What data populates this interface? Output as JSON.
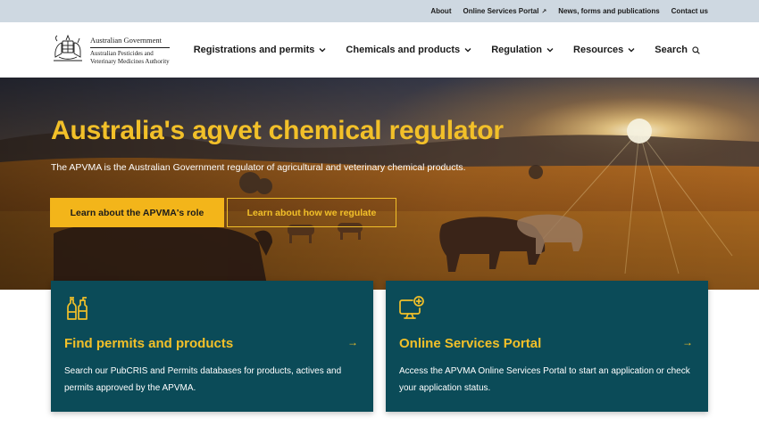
{
  "utility": {
    "links": [
      {
        "label": "About"
      },
      {
        "label": "Online Services Portal",
        "external_icon": "external-link-icon"
      },
      {
        "label": "News, forms and publications"
      },
      {
        "label": "Contact us"
      }
    ]
  },
  "logo": {
    "government": "Australian Government",
    "agency_line1": "Australian Pesticides and",
    "agency_line2": "Veterinary Medicines Authority",
    "icon": "coat-of-arms-icon"
  },
  "nav": {
    "items": [
      {
        "label": "Registrations and permits",
        "icon": "chevron-down-icon"
      },
      {
        "label": "Chemicals and products",
        "icon": "chevron-down-icon"
      },
      {
        "label": "Regulation",
        "icon": "chevron-down-icon"
      },
      {
        "label": "Resources",
        "icon": "chevron-down-icon"
      }
    ],
    "search_label": "Search",
    "search_icon": "search-icon"
  },
  "hero": {
    "title": "Australia's agvet chemical regulator",
    "description": "The APVMA is the Australian Government regulator of agricultural and veterinary chemical products.",
    "primary_button": "Learn about the APVMA's role",
    "secondary_button": "Learn about how we regulate"
  },
  "cards": [
    {
      "title": "Find permits and products",
      "description": "Search our PubCRIS and Permits databases for products, actives and permits approved by the APVMA.",
      "icon": "chemical-bottles-icon",
      "arrow": "→"
    },
    {
      "title": "Online Services Portal",
      "description": "Access the APVMA Online Services Portal to start an application or check your application status.",
      "icon": "computer-add-icon",
      "arrow": "→"
    }
  ],
  "colors": {
    "accent_yellow": "#f2c029",
    "button_yellow": "#f3b51a",
    "card_teal": "#0b4b58",
    "utility_bar": "#ced8e1"
  }
}
